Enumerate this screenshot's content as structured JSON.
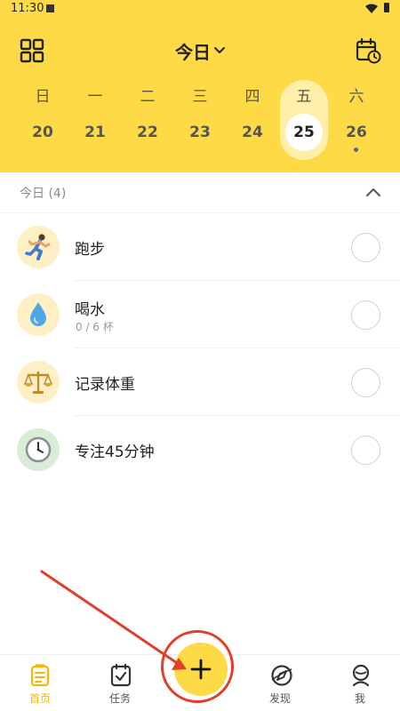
{
  "status_bar": {
    "time": "11:30"
  },
  "top_bar": {
    "title": "今日"
  },
  "week": {
    "days": [
      {
        "weekday": "日",
        "date": "20"
      },
      {
        "weekday": "一",
        "date": "21"
      },
      {
        "weekday": "二",
        "date": "22"
      },
      {
        "weekday": "三",
        "date": "23"
      },
      {
        "weekday": "四",
        "date": "24"
      },
      {
        "weekday": "五",
        "date": "25"
      },
      {
        "weekday": "六",
        "date": "26"
      }
    ],
    "selected_date": "25",
    "dot_date": "26"
  },
  "section": {
    "title": "今日 (4)"
  },
  "tasks": [
    {
      "name": "跑步",
      "subtitle": "",
      "icon": "running-icon"
    },
    {
      "name": "喝水",
      "subtitle": "0 / 6 杯",
      "icon": "water-drop-icon"
    },
    {
      "name": "记录体重",
      "subtitle": "",
      "icon": "scale-icon"
    },
    {
      "name": "专注45分钟",
      "subtitle": "",
      "icon": "clock-icon"
    }
  ],
  "tabbar": {
    "home": "首页",
    "tasks": "任务",
    "discover": "发现",
    "me": "我",
    "active": "home"
  },
  "colors": {
    "brand_yellow": "#FEDA47",
    "selected_day_bg": "#FFEFA8",
    "active_tab": "#F5B800",
    "annotation_red": "#E0402A"
  }
}
